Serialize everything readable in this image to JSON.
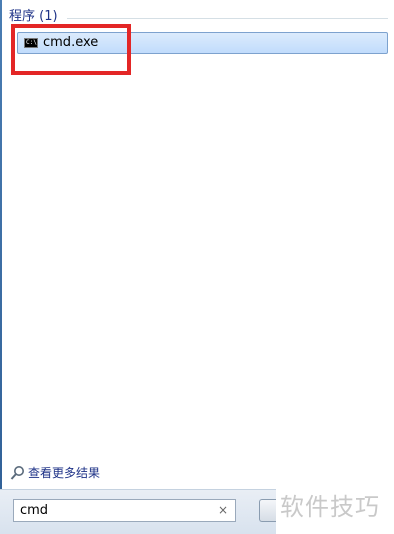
{
  "programs_section": {
    "title": "程序 (1)"
  },
  "results": [
    {
      "label": "cmd.exe",
      "icon": "cmd-icon"
    }
  ],
  "see_more": {
    "label": "查看更多结果",
    "icon": "search-icon"
  },
  "search": {
    "value": "cmd",
    "clear_symbol": "×"
  },
  "watermark": {
    "text": "软件技巧"
  },
  "colors": {
    "highlight_box": "#e32626",
    "selection": "#c1dcfc",
    "link": "#1e3287"
  }
}
